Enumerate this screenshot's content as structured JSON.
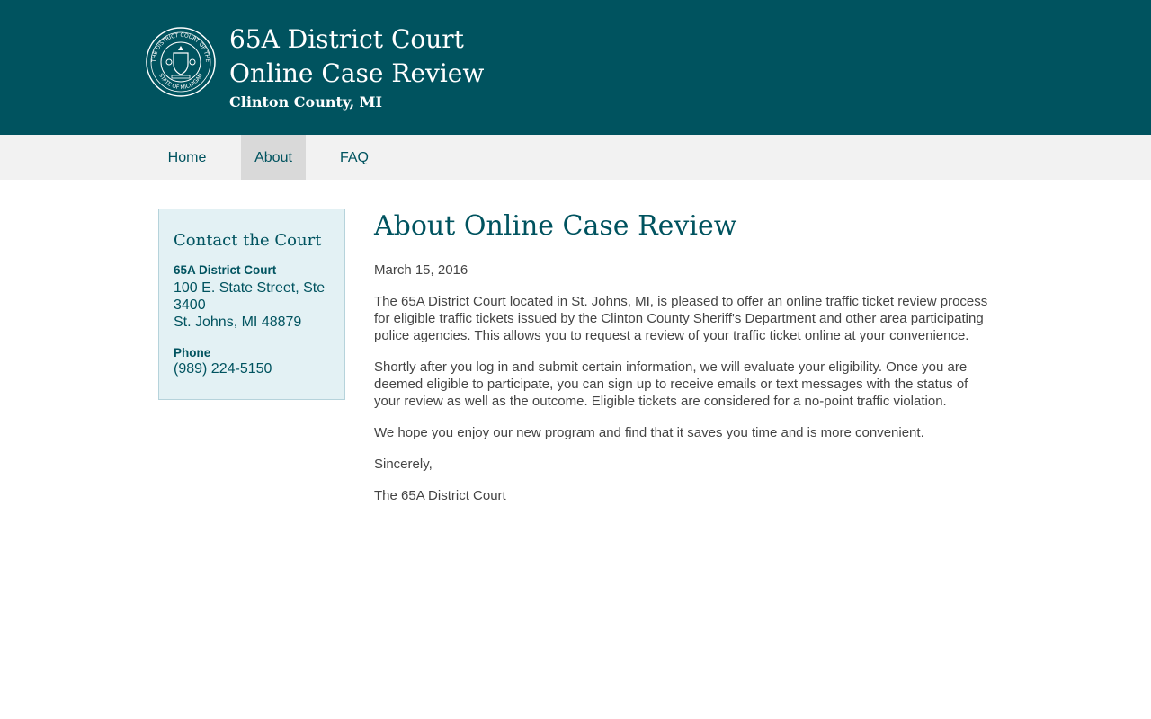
{
  "header": {
    "title_line1": "65A District Court",
    "title_line2": "Online Case Review",
    "subtitle": "Clinton County, MI",
    "seal_text_top": "THE DISTRICT COURT OF THE",
    "seal_text_bottom": "STATE OF MICHIGAN"
  },
  "nav": {
    "items": [
      {
        "label": "Home"
      },
      {
        "label": "About"
      },
      {
        "label": "FAQ"
      }
    ],
    "active": "About"
  },
  "sidebar": {
    "title": "Contact the Court",
    "court_name": "65A District Court",
    "address_line1": "100 E. State Street, Ste 3400",
    "address_line2": "St. Johns, MI 48879",
    "phone_label": "Phone",
    "phone": "(989) 224-5150"
  },
  "main": {
    "title": "About Online Case Review",
    "date": "March 15, 2016",
    "paragraphs": [
      "The 65A District Court located in St. Johns, MI, is pleased to offer an online traffic ticket review process for eligible traffic tickets issued by the Clinton County Sheriff's Department and other area participating police agencies. This allows you to request a review of your traffic ticket online at your convenience.",
      "Shortly after you log in and submit certain information, we will evaluate your eligibility. Once you are deemed eligible to participate, you can sign up to receive emails or text messages with the status of your review as well as the outcome. Eligible tickets are considered for a no-point traffic violation.",
      "We hope you enjoy our new program and find that it saves you time and is more convenient.",
      "Sincerely,",
      "The 65A District Court"
    ]
  },
  "colors": {
    "brand": "#00535f",
    "nav_bg": "#f2f2f2",
    "nav_active_bg": "#d9d9d9",
    "sidebar_bg": "#e3f1f4"
  }
}
